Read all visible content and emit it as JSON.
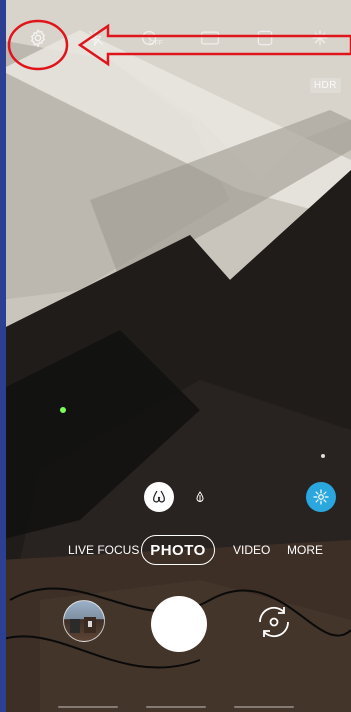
{
  "top_bar": {
    "icons": [
      "settings-icon",
      "flash-off-icon",
      "timer-off-icon",
      "aspect-ratio-icon",
      "motion-photo-icon",
      "filter-icon"
    ],
    "timer_label": "OFF"
  },
  "hdr_badge": "HDR",
  "annotation": {
    "circle_color": "#e0141b",
    "arrow_color": "#e0141b"
  },
  "zoom": {
    "icons": [
      "wide-angle-icon",
      "telephoto-icon"
    ],
    "effects_icon": "bixby-vision-icon",
    "effects_color": "#2aa7de"
  },
  "modes": {
    "items": [
      "LIVE FOCUS",
      "PHOTO",
      "VIDEO",
      "MORE"
    ],
    "selected": "PHOTO"
  },
  "bottom_bar": {
    "icons": [
      "gallery-thumbnail",
      "shutter-button",
      "flip-camera-icon"
    ]
  }
}
